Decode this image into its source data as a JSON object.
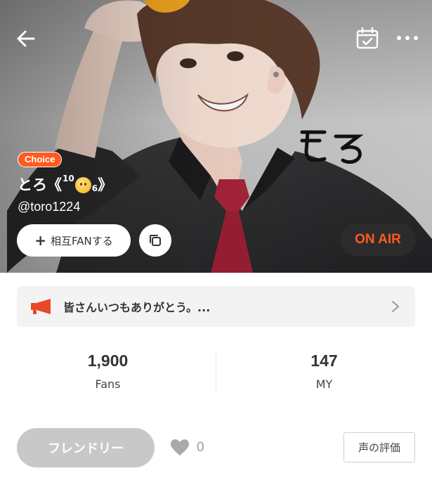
{
  "header": {
    "back_icon": "arrow-left-icon",
    "calendar_icon": "calendar-check-icon",
    "more_icon": "more-horizontal-icon"
  },
  "hero": {
    "image": "illustrated-portrait-dark-shirt-red-tie",
    "art_text": "とろ"
  },
  "profile": {
    "badge": "Choice",
    "name_prefix": "とろ《",
    "name_sup": "10",
    "name_sub": "6",
    "name_suffix": "》",
    "handle": "@toro1224"
  },
  "actions": {
    "fan_label": "相互FANする",
    "fan_icon": "plus-icon",
    "copy_icon": "copy-icon",
    "onair_label": "ON AIR"
  },
  "announcement": {
    "icon": "megaphone-icon",
    "text": "皆さんいつもありがとう。...",
    "chevron_icon": "chevron-right-icon"
  },
  "stats": [
    {
      "value": "1,900",
      "label": "Fans"
    },
    {
      "value": "147",
      "label": "MY"
    }
  ],
  "footer": {
    "friendly_label": "フレンドリー",
    "like_icon": "heart-icon",
    "like_count": "0",
    "voice_label": "声の評価"
  },
  "colors": {
    "accent": "#ff5a1f",
    "onair_bg": "#2d2d2d",
    "friendly_bg": "#c8c8c8",
    "announce_bg": "#f3f3f3"
  }
}
